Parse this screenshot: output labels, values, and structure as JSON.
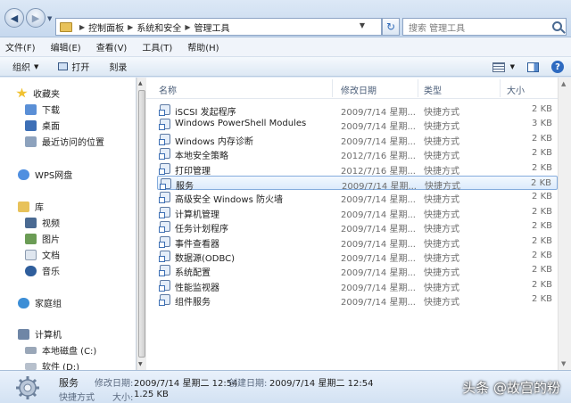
{
  "address": {
    "crumbs": [
      "控制面板",
      "系统和安全",
      "管理工具"
    ],
    "search_placeholder": "搜索 管理工具"
  },
  "menu": [
    "文件(F)",
    "编辑(E)",
    "查看(V)",
    "工具(T)",
    "帮助(H)"
  ],
  "toolbar": {
    "organize": "组织",
    "open": "打开",
    "burn": "刻录"
  },
  "nav": {
    "favorites": "收藏夹",
    "downloads": "下载",
    "desktop": "桌面",
    "recent": "最近访问的位置",
    "wps": "WPS网盘",
    "libraries": "库",
    "videos": "视频",
    "pictures": "图片",
    "documents": "文档",
    "music": "音乐",
    "homegroup": "家庭组",
    "computer": "计算机",
    "local_disk": "本地磁盘 (C:)",
    "soft_disk": "软件 (D:)"
  },
  "columns": {
    "name": "名称",
    "date": "修改日期",
    "type": "类型",
    "size": "大小"
  },
  "files": [
    {
      "name": "iSCSI 发起程序",
      "date": "2009/7/14 星期...",
      "type": "快捷方式",
      "size": "2 KB"
    },
    {
      "name": "Windows PowerShell Modules",
      "date": "2009/7/14 星期...",
      "type": "快捷方式",
      "size": "3 KB"
    },
    {
      "name": "Windows 内存诊断",
      "date": "2009/7/14 星期...",
      "type": "快捷方式",
      "size": "2 KB"
    },
    {
      "name": "本地安全策略",
      "date": "2012/7/16 星期...",
      "type": "快捷方式",
      "size": "2 KB"
    },
    {
      "name": "打印管理",
      "date": "2012/7/16 星期...",
      "type": "快捷方式",
      "size": "2 KB"
    },
    {
      "name": "服务",
      "date": "2009/7/14 星期...",
      "type": "快捷方式",
      "size": "2 KB"
    },
    {
      "name": "高级安全 Windows 防火墙",
      "date": "2009/7/14 星期...",
      "type": "快捷方式",
      "size": "2 KB"
    },
    {
      "name": "计算机管理",
      "date": "2009/7/14 星期...",
      "type": "快捷方式",
      "size": "2 KB"
    },
    {
      "name": "任务计划程序",
      "date": "2009/7/14 星期...",
      "type": "快捷方式",
      "size": "2 KB"
    },
    {
      "name": "事件查看器",
      "date": "2009/7/14 星期...",
      "type": "快捷方式",
      "size": "2 KB"
    },
    {
      "name": "数据源(ODBC)",
      "date": "2009/7/14 星期...",
      "type": "快捷方式",
      "size": "2 KB"
    },
    {
      "name": "系统配置",
      "date": "2009/7/14 星期...",
      "type": "快捷方式",
      "size": "2 KB"
    },
    {
      "name": "性能监视器",
      "date": "2009/7/14 星期...",
      "type": "快捷方式",
      "size": "2 KB"
    },
    {
      "name": "组件服务",
      "date": "2009/7/14 星期...",
      "type": "快捷方式",
      "size": "2 KB"
    }
  ],
  "selected_index": 5,
  "details": {
    "name": "服务",
    "type": "快捷方式",
    "modified_label": "修改日期:",
    "modified_value": "2009/7/14 星期二 12:54",
    "created_label": "创建日期:",
    "created_value": "2009/7/14 星期二 12:54",
    "size_label": "大小:",
    "size_value": "1.25 KB"
  },
  "watermark": "头条 @故宫的粉",
  "colors": {
    "selection_border": "#84acdd",
    "chrome": "#dfe9f5"
  }
}
